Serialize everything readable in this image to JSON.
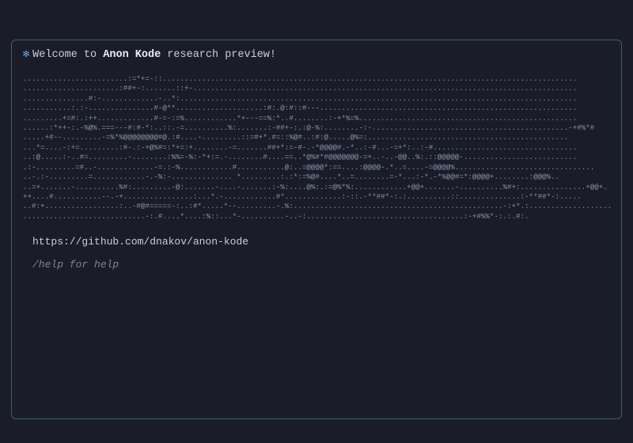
{
  "welcome": {
    "star": "✻",
    "prefix": "Welcome to ",
    "bold": "Anon Kode",
    "suffix": " research preview!"
  },
  "ascii_lines": [
    "........................:=*+=-::...............................................................................................",
    "......................:##+-:.......::+-........................................................................................",
    "...............#:-.............-..*:...........................................................................................",
    "...........:.:-...............#-@**....................:#:.@:#::#---...........................................................",
    ".........+=#:.:++.............#-=-:=%............*+---==%:*..#........:-+*%=%..................................................",
    "......:*++-:.-%@%.===---#:#-*:..::.-=..........%:.......:-##+-:.:@-%:........-:-.............................................-+#%*#",
    ".....+#--.........-=%*%@@@@@@@@#@.:#....-.........::=#+*.#=::%@#..:#:@.....@%=:..............................................",
    "...*=....-:+=.........:#-.:-+@%#=:*+=:+........-=.......##+*:=-#-.-*@@@@#.-*..:-#...-=+*:..:-#.................................",
    "..:@.....:-..#=.........-........:%%=-%:-*+:=.-........#....==..*@%#*#@@@@@@@-=+..-..-@@..%:.::@@@@@-..........................",
    ".:-.........=#..-.............-=.:-%............#...........@:..=@@@@*:==....:@@@@-.*..=....-=@@@@%................................",
    "..-.:-.........=............-.-%:-.............. *.........:.:*:=%@#....*..=........=-*...:-*.-*%@@#=*:@@@@+........:@@@%..",
    "..=+.......-..........%#:.........-@:.......-....-.......:-%:....@%:.:=@%*%:............+@@+.......-..........%#+:...............+@@+.",
    "++....#...........--.-+................:...*.-............#*.............:-::.-**##*-:.:..........::..............:-**##*-:.....",
    "..#:+.................:..-#@#=====-:..:#*.....*--.........-.%:................................................-:+*.:...................",
    "............................-:.#....*....:%::...*-..........-..-:....................................:-+#%%*-:.:.#:."
  ],
  "url": "https://github.com/dnakov/anon-kode",
  "help": "/help for help"
}
